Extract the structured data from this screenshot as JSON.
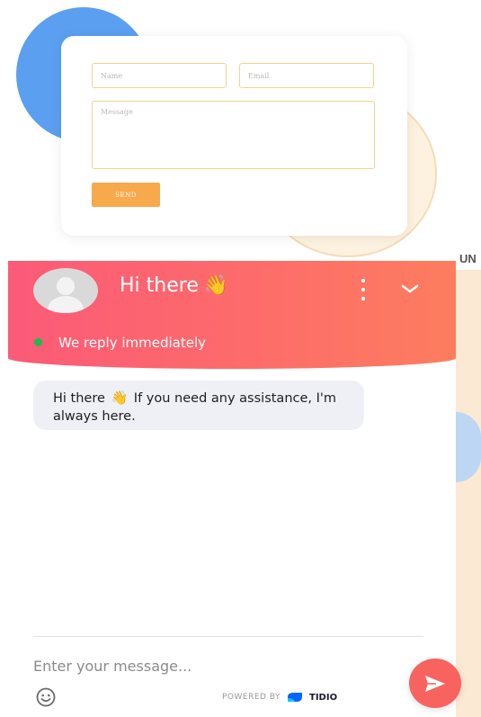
{
  "contact_form": {
    "name_placeholder": "Name",
    "email_placeholder": "Email",
    "message_placeholder": "Message",
    "send_label": "SEND"
  },
  "page": {
    "edge_text": "UN"
  },
  "chat": {
    "header": {
      "greeting": "Hi there",
      "greeting_emoji": "👋",
      "status_text": "We reply immediately",
      "more_icon": "vertical-dots-icon",
      "collapse_icon": "chevron-down-icon"
    },
    "message": {
      "text_before": "Hi there",
      "emoji": "👋",
      "text_after": " If you need any assistance, I'm always here."
    },
    "input": {
      "placeholder": "Enter your message..."
    },
    "footer": {
      "powered_by": "POWERED BY",
      "brand": "TIDIO",
      "emoji_icon": "smiley-icon",
      "send_icon": "paper-plane-icon"
    }
  },
  "colors": {
    "header_start": "#fb5a78",
    "header_end": "#fd7d5e",
    "status_online": "#1dbb4f",
    "send_button": "#f7a94b",
    "fab": "#f9635f"
  }
}
